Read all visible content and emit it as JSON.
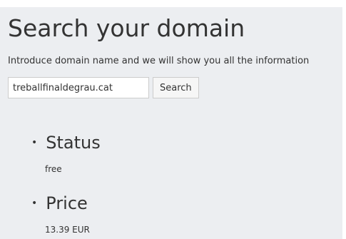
{
  "header": {
    "title": "Search your domain",
    "subtitle": "Introduce domain name and we will show you all the information"
  },
  "search": {
    "value": "treballfinaldegrau.cat",
    "button_label": "Search"
  },
  "results": [
    {
      "label": "Status",
      "value": "free"
    },
    {
      "label": "Price",
      "value": "13.39 EUR"
    }
  ],
  "colors": {
    "panel_background": "#eceef1",
    "text": "#333333",
    "input_border": "#cccccc"
  },
  "icons": {
    "bullet": "bullet-icon"
  }
}
